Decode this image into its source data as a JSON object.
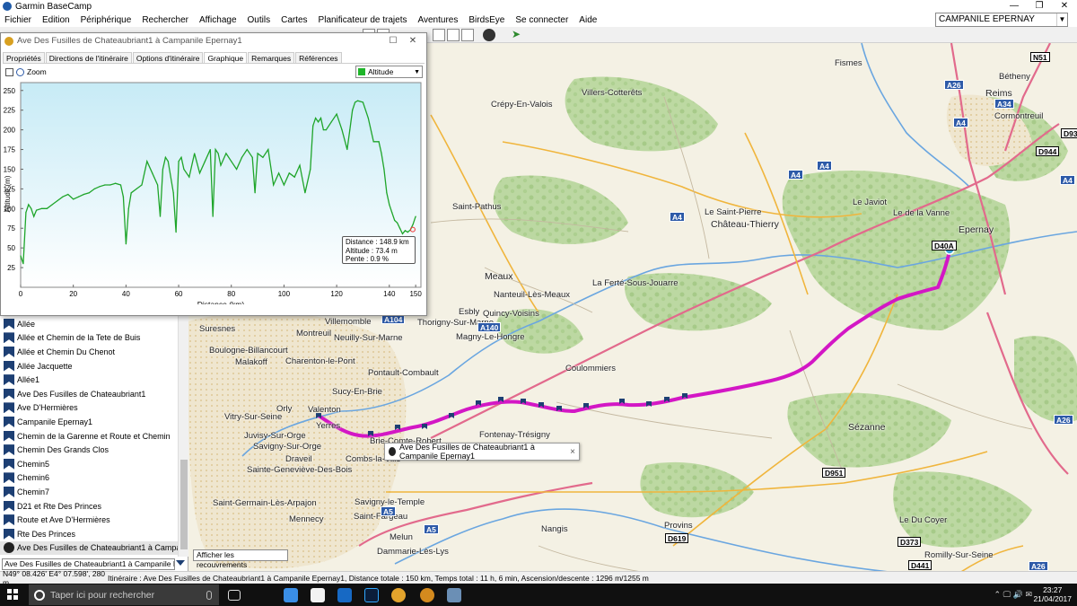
{
  "app": {
    "title": "Garmin BaseCamp",
    "window_controls": [
      "—",
      "❐",
      "✕"
    ]
  },
  "menu": [
    "Fichier",
    "Edition",
    "Périphérique",
    "Rechercher",
    "Affichage",
    "Outils",
    "Cartes",
    "Planificateur de trajets",
    "Aventures",
    "BirdsEye",
    "Se connecter",
    "Aide"
  ],
  "search": {
    "value": "CAMPANILE EPERNAY"
  },
  "profile_window": {
    "title": "Ave Des Fusilles de Chateaubriant1 à Campanile Epernay1",
    "controls": [
      "☐",
      "✕"
    ],
    "tabs": [
      "Propriétés",
      "Directions de l'itinéraire",
      "Options d'itinéraire",
      "Graphique",
      "Remarques",
      "Références"
    ],
    "active_tab": "Graphique",
    "zoom_label": "Zoom",
    "metric": "Altitude",
    "metric_color": "#1fb52a",
    "tooltip": [
      "Distance : 148.9 km",
      "Altitude : 73.4 m",
      "Pente : 0.9 %"
    ]
  },
  "chart_data": {
    "type": "line",
    "title": "",
    "xlabel": "Distance  (km)",
    "ylabel": "Altitude (m)",
    "xlim": [
      0,
      152
    ],
    "ylim": [
      0,
      260
    ],
    "xticks": [
      0,
      20,
      40,
      60,
      80,
      100,
      120,
      140,
      150
    ],
    "yticks": [
      25,
      50,
      75,
      100,
      125,
      150,
      175,
      200,
      225,
      250
    ],
    "grid": false,
    "series": [
      {
        "color": "#1fa52a",
        "x": [
          0,
          1,
          2,
          3,
          4,
          5,
          6,
          8,
          10,
          12,
          14,
          16,
          18,
          20,
          22,
          24,
          26,
          28,
          30,
          32,
          34,
          36,
          38,
          39,
          40,
          41,
          42,
          44,
          46,
          48,
          50,
          52,
          53,
          54,
          55,
          56,
          58,
          59,
          60,
          61,
          62,
          64,
          66,
          68,
          70,
          72,
          73,
          74,
          75,
          76,
          78,
          80,
          82,
          84,
          86,
          88,
          89,
          90,
          92,
          94,
          96,
          98,
          100,
          102,
          104,
          106,
          108,
          110,
          111,
          112,
          113,
          114,
          115,
          116,
          118,
          120,
          122,
          124,
          125,
          126,
          127,
          128,
          130,
          132,
          134,
          136,
          137,
          138,
          139,
          140,
          141,
          142,
          143,
          144,
          145,
          146,
          147,
          148,
          149,
          150
        ],
        "y": [
          40,
          30,
          95,
          105,
          100,
          90,
          98,
          100,
          100,
          105,
          110,
          115,
          118,
          112,
          115,
          118,
          120,
          125,
          128,
          130,
          130,
          132,
          130,
          115,
          55,
          100,
          120,
          125,
          130,
          160,
          145,
          130,
          90,
          150,
          165,
          160,
          120,
          70,
          160,
          165,
          150,
          140,
          170,
          145,
          160,
          175,
          90,
          175,
          170,
          155,
          170,
          160,
          150,
          165,
          175,
          165,
          120,
          170,
          165,
          175,
          130,
          145,
          130,
          145,
          140,
          155,
          120,
          150,
          205,
          215,
          210,
          215,
          200,
          200,
          210,
          220,
          200,
          175,
          200,
          225,
          235,
          237,
          235,
          215,
          185,
          185,
          170,
          150,
          120,
          105,
          95,
          85,
          82,
          75,
          68,
          72,
          70,
          73,
          80,
          90
        ]
      }
    ]
  },
  "route_list": [
    "Allée",
    "Allée et Chemin de la Tete de Buis",
    "Allée et Chemin Du Chenot",
    "Allée Jacquette",
    "Allée1",
    "Ave Des Fusilles de Chateaubriant1",
    "Ave D'Hermières",
    "Campanile Epernay1",
    "Chemin de la Garenne et Route et Chemin",
    "Chemin Des Grands Clos",
    "Chemin5",
    "Chemin6",
    "Chemin7",
    "D21 et Rte Des Princes",
    "Route et Ave D'Hermières",
    "Rte Des Princes",
    "Ave Des Fusilles de Chateaubriant1 à Campanile Epern"
  ],
  "route_select": "Ave Des Fusilles de Chateaubriant1 à Campanile Eper",
  "overlay_select": "Afficher les recouvrements",
  "map": {
    "tooltip": "Ave Des Fusilles de Chateaubriant1 à Campanile Epernay1",
    "tooltip_close": "×",
    "places": [
      {
        "name": "Fismes",
        "big": false
      },
      {
        "name": "Bétheny",
        "big": false
      },
      {
        "name": "Reims",
        "big": true
      },
      {
        "name": "Cormontreuil",
        "big": false
      },
      {
        "name": "Villers-Cotterêts",
        "big": false
      },
      {
        "name": "Crépy-En-Valois",
        "big": false
      },
      {
        "name": "Saint-Pathus",
        "big": false
      },
      {
        "name": "Château-Thierry",
        "big": true
      },
      {
        "name": "Epernay",
        "big": true
      },
      {
        "name": "Meaux",
        "big": true
      },
      {
        "name": "Nanteuil-Lès-Meaux",
        "big": false
      },
      {
        "name": "La Ferté-Sous-Jouarre",
        "big": false
      },
      {
        "name": "Esbly",
        "big": false
      },
      {
        "name": "Quincy-Voisins",
        "big": false
      },
      {
        "name": "Thorigny-Sur-Marne",
        "big": false
      },
      {
        "name": "Magny-Le-Hongre",
        "big": false
      },
      {
        "name": "Coulommiers",
        "big": false
      },
      {
        "name": "Villemomble",
        "big": false
      },
      {
        "name": "Suresnes",
        "big": false
      },
      {
        "name": "Montreuil",
        "big": false
      },
      {
        "name": "Neuilly-Sur-Marne",
        "big": false
      },
      {
        "name": "Boulogne-Billancourt",
        "big": false
      },
      {
        "name": "Malakoff",
        "big": false
      },
      {
        "name": "Charenton-le-Pont",
        "big": false
      },
      {
        "name": "Pontault-Combault",
        "big": false
      },
      {
        "name": "Sucy-En-Brie",
        "big": false
      },
      {
        "name": "Valenton",
        "big": false
      },
      {
        "name": "Yerres",
        "big": false
      },
      {
        "name": "Brie-Comte-Robert",
        "big": false
      },
      {
        "name": "Fontenay-Trésigny",
        "big": false
      },
      {
        "name": "Vitry-Sur-Seine",
        "big": false
      },
      {
        "name": "Orly",
        "big": false
      },
      {
        "name": "Juvisy-Sur-Orge",
        "big": false
      },
      {
        "name": "Savigny-Sur-Orge",
        "big": false
      },
      {
        "name": "Draveil",
        "big": false
      },
      {
        "name": "Combs-la-Ville",
        "big": false
      },
      {
        "name": "Sainte-Geneviève-Des-Bois",
        "big": false
      },
      {
        "name": "Saint-Germain-Lès-Arpajon",
        "big": false
      },
      {
        "name": "Mennecy",
        "big": false
      },
      {
        "name": "Savigny-le-Temple",
        "big": false
      },
      {
        "name": "Saint-Fargeau",
        "big": false
      },
      {
        "name": "Melun",
        "big": false
      },
      {
        "name": "Dammarie-Lès-Lys",
        "big": false
      },
      {
        "name": "Nangis",
        "big": false
      },
      {
        "name": "Provins",
        "big": false
      },
      {
        "name": "Sézanne",
        "big": true
      },
      {
        "name": "Romilly-Sur-Seine",
        "big": false
      },
      {
        "name": "Le Du Coyer",
        "big": false
      },
      {
        "name": "Le Javiot",
        "big": false
      },
      {
        "name": "Le de la Vanne",
        "big": false
      },
      {
        "name": "Le Saint-Pierre",
        "big": false
      }
    ],
    "shields": [
      {
        "label": "N51",
        "kind": "n"
      },
      {
        "label": "A26",
        "kind": "a"
      },
      {
        "label": "A34",
        "kind": "a"
      },
      {
        "label": "A4",
        "kind": "a"
      },
      {
        "label": "D93",
        "kind": "n"
      },
      {
        "label": "D944",
        "kind": "n"
      },
      {
        "label": "A4",
        "kind": "a"
      },
      {
        "label": "A4",
        "kind": "a"
      },
      {
        "label": "A4",
        "kind": "a"
      },
      {
        "label": "A4",
        "kind": "a"
      },
      {
        "label": "D40A",
        "kind": "n"
      },
      {
        "label": "A140",
        "kind": "a"
      },
      {
        "label": "N4",
        "kind": "n"
      },
      {
        "label": "A26",
        "kind": "a"
      },
      {
        "label": "D951",
        "kind": "n"
      },
      {
        "label": "A5",
        "kind": "a"
      },
      {
        "label": "A5",
        "kind": "a"
      },
      {
        "label": "D619",
        "kind": "n"
      },
      {
        "label": "D373",
        "kind": "n"
      },
      {
        "label": "D441",
        "kind": "n"
      },
      {
        "label": "A26",
        "kind": "a"
      },
      {
        "label": "A104",
        "kind": "a"
      }
    ]
  },
  "status": {
    "coords": "N49° 08.426' E4° 07.598', 280 m",
    "info": "Itinéraire : Ave Des Fusilles de Chateaubriant1 à Campanile Epernay1, Distance totale : 150 km, Temps total : 11 h, 6 min, Ascension/descente : 1296 m/1255 m"
  },
  "taskbar": {
    "search_placeholder": "Taper ici pour rechercher",
    "time": "23:27",
    "date": "21/04/2017",
    "tray": "⌃ 🖵 🔊 ✉"
  }
}
